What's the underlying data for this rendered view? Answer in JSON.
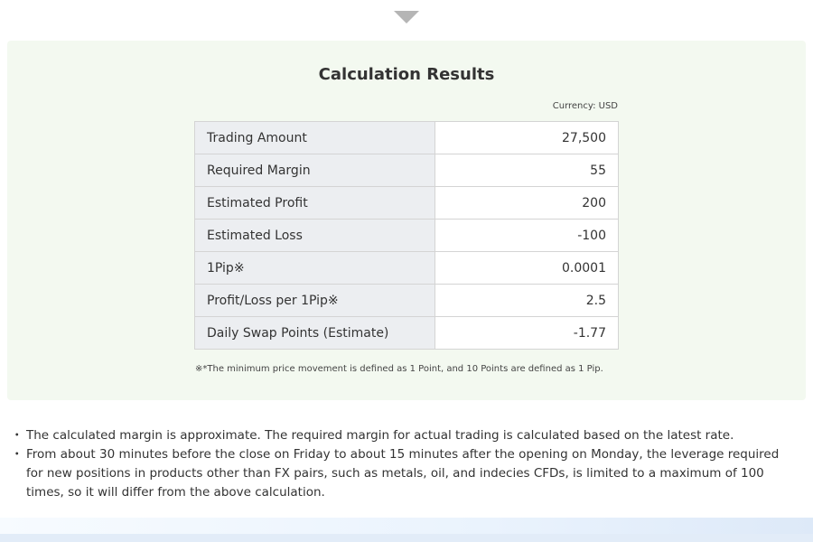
{
  "results": {
    "title": "Calculation Results",
    "currency_label": "Currency: USD",
    "rows": [
      {
        "label": "Trading Amount",
        "value": "27,500"
      },
      {
        "label": "Required Margin",
        "value": "55"
      },
      {
        "label": "Estimated Profit",
        "value": "200"
      },
      {
        "label": "Estimated Loss",
        "value": "-100"
      },
      {
        "label": "1Pip※",
        "value": "0.0001"
      },
      {
        "label": "Profit/Loss per 1Pip※",
        "value": "2.5"
      },
      {
        "label": "Daily Swap Points (Estimate)",
        "value": "-1.77"
      }
    ],
    "footnote": "※*The minimum price movement is defined as 1 Point, and 10 Points are defined as 1 Pip."
  },
  "notes": {
    "bullet": "・",
    "items": [
      "The calculated margin is approximate. The required margin for actual trading is calculated based on the latest rate.",
      "From about 30 minutes before the close on Friday to about 15 minutes after the opening on Monday, the leverage required for new positions in products other than FX pairs, such as metals, oil, and indecies CFDs, is limited to a maximum of 100 times, so it will differ from the above calculation."
    ]
  },
  "icons": {
    "arrow": "chevron-down-icon"
  },
  "colors": {
    "panel_background": "#f3f9f0",
    "label_cell_background": "#eceef1",
    "arrow": "#b5b5b5"
  }
}
